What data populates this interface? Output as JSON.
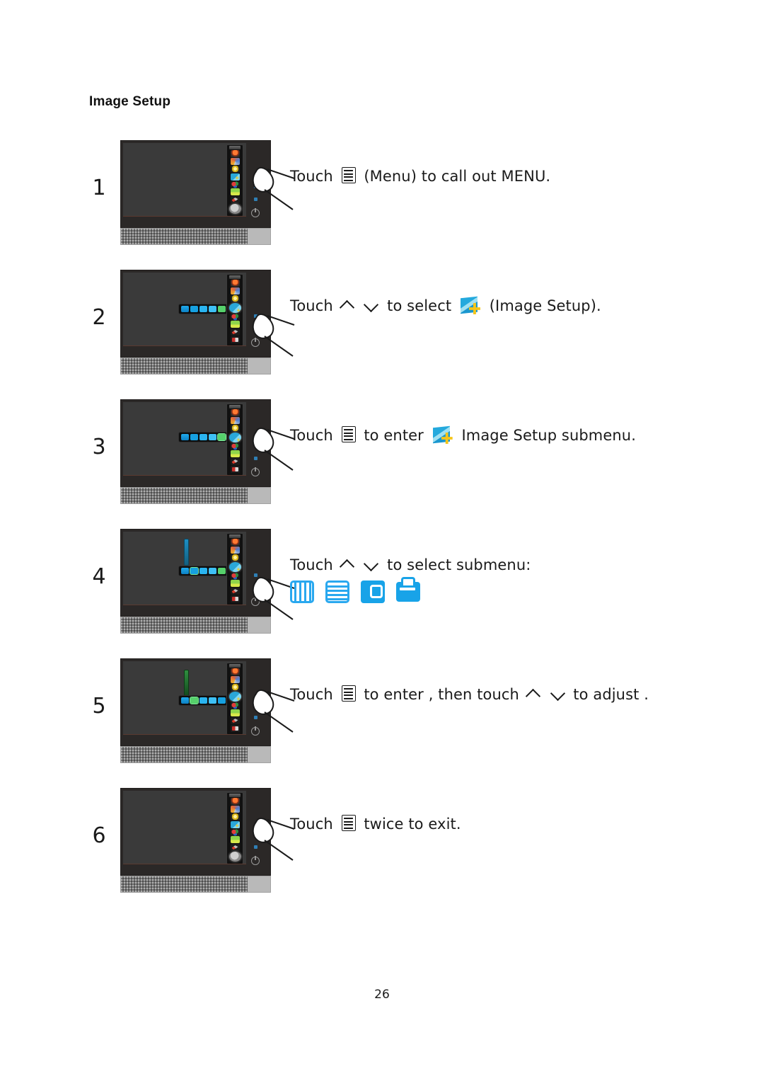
{
  "document": {
    "section_title": "Image Setup",
    "page_number": "26"
  },
  "steps": [
    {
      "number": "1",
      "text_before": "Touch",
      "text_after": "(Menu) to  call out MENU.",
      "icons": [
        "menu-icon"
      ],
      "monitor_state": "osd-main-menu-closed"
    },
    {
      "number": "2",
      "text_before": "Touch",
      "text_mid": "to select",
      "text_after": "(Image Setup).",
      "icons": [
        "chevron-up-icon",
        "chevron-down-icon",
        "image-setup-icon"
      ],
      "monitor_state": "osd-submenu-row-visible"
    },
    {
      "number": "3",
      "text_before": "Touch",
      "text_mid": "to enter",
      "text_after": "Image Setup  submenu.",
      "icons": [
        "menu-icon",
        "image-setup-icon"
      ],
      "monitor_state": "osd-submenu-row-visible"
    },
    {
      "number": "4",
      "text_before": "Touch",
      "text_mid": "to select submenu:",
      "text_after": "",
      "icons": [
        "chevron-up-icon",
        "chevron-down-icon"
      ],
      "submenu_icons": [
        "clock-icon",
        "phase-icon",
        "h-position-icon",
        "v-position-icon"
      ],
      "monitor_state": "osd-submenu-with-blue-slider"
    },
    {
      "number": "5",
      "text_before": "Touch",
      "text_mid": "to enter ,  then touch",
      "text_after": "to  adjust .",
      "icons": [
        "menu-icon",
        "chevron-up-icon",
        "chevron-down-icon"
      ],
      "monitor_state": "osd-submenu-with-green-slider"
    },
    {
      "number": "6",
      "text_before": "Touch",
      "text_after": "twice to exit.",
      "icons": [
        "menu-icon"
      ],
      "monitor_state": "osd-main-menu-closed"
    }
  ],
  "monitor": {
    "osd_column_icons": [
      "luminance-icon",
      "image-color-icon",
      "brightness-icon",
      "image-setup-icon",
      "color-setup-icon",
      "picture-boost-icon",
      "osd-setup-icon",
      "extra-icon"
    ],
    "submenu_row_icons": [
      "clock-icon",
      "phase-icon",
      "h-position-icon",
      "v-position-icon",
      "exit-icon"
    ],
    "power_button": "power-icon",
    "led_indicators": [
      "led-indicator-1",
      "led-indicator-2"
    ]
  },
  "colors": {
    "accent_blue": "#29a8ef",
    "osd_highlight": "#18a3e8",
    "slider_blue": "#1c8fc4",
    "slider_green": "#2f8f3f",
    "text": "#1a1a1a",
    "monitor_body": "#2b2827",
    "monitor_screen": "#3a3a3a"
  }
}
